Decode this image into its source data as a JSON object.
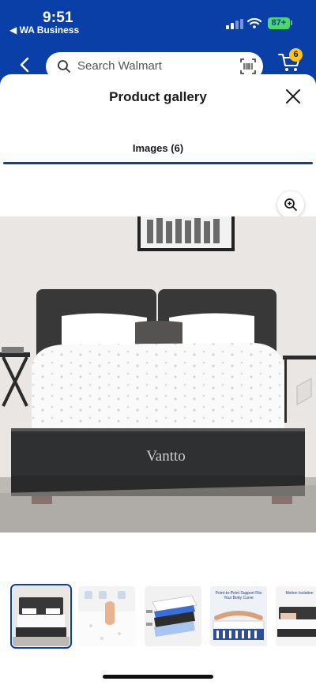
{
  "status_bar": {
    "time": "9:51",
    "back_app": "◀ WA Business",
    "battery": "87+"
  },
  "header": {
    "search_placeholder": "Search Walmart",
    "cart_count": "6",
    "brand_color": "#0b3fa8",
    "badge_color": "#ffc220"
  },
  "gallery": {
    "title": "Product gallery",
    "tab_label": "Images (6)",
    "product_wordmark": "Vantto",
    "thumbnail_count": 5,
    "thumbnails": [
      {
        "label": "bed-front-view",
        "selected": true
      },
      {
        "label": "hand-pressing-foam",
        "selected": false
      },
      {
        "label": "layers-cutaway",
        "selected": false
      },
      {
        "label": "",
        "caption": "Point-to-Point Support Fits Your Body Curve",
        "selected": false
      },
      {
        "label": "",
        "caption": "Motion Isolation",
        "selected": false
      }
    ]
  }
}
